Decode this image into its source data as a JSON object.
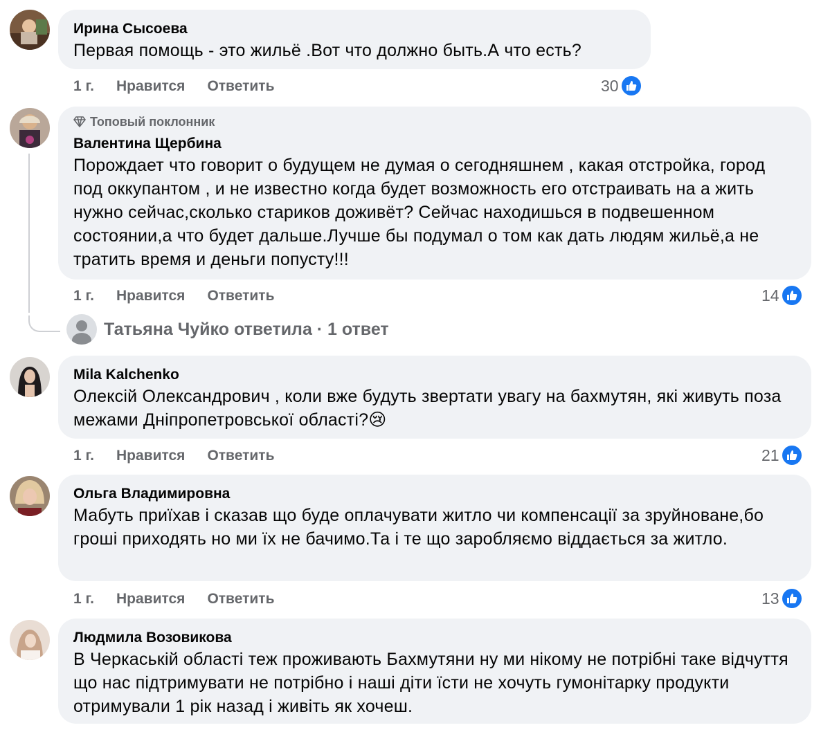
{
  "meta_labels": {
    "like": "Нравится",
    "reply": "Ответить"
  },
  "comments": [
    {
      "author": "Ирина Сысоева",
      "text": "Первая помощь - это жильё .Вот что должно быть.А что есть?",
      "time": "1 г.",
      "likes": "30"
    },
    {
      "badge": "Топовый поклонник",
      "author": "Валентина Щербина",
      "text": "Порождает что говорит о будущем не думая о сегодняшнем , какая отстройка, город под оккупантом , и не известно когда будет возможность его отстраивать на а жить нужно сейчас,сколько стариков доживёт? Сейчас находишься в подвешенном состоянии,а что будет дальше.Лучше бы подумал о том как дать людям жильё,а не тратить время и деньги попусту!!!",
      "time": "1 г.",
      "likes": "14",
      "reply_summary": "Татьяна Чуйко ответила · 1 ответ"
    },
    {
      "author": "Mila Kalchenko",
      "text": "Олексій Олександрович , коли вже будуть звертати увагу на бахмутян, які живуть поза межами Дніпропетровської області?",
      "emoji": "😢",
      "time": "1 г.",
      "likes": "21"
    },
    {
      "author": "Ольга Владимировна",
      "text": "Мабуть приїхав і сказав що буде оплачувати житло чи компенсації за зруйноване,бо гроші приходять но ми їх не бачимо.Та і те що заробляємо віддається за житло.",
      "time": "1 г.",
      "likes": "13"
    },
    {
      "author": "Людмила Возовикова",
      "text": "В Черкаській області теж проживають Бахмутяни ну ми нікому не потрібні таке відчуття що нас підтримувати не потрібно і наші діти їсти не хочуть гумонітарку продукти отримували 1 рік назад і живіть як хочеш."
    }
  ],
  "colors": {
    "bubble": "#f0f2f5",
    "meta": "#65676b",
    "like": "#1877f2"
  }
}
